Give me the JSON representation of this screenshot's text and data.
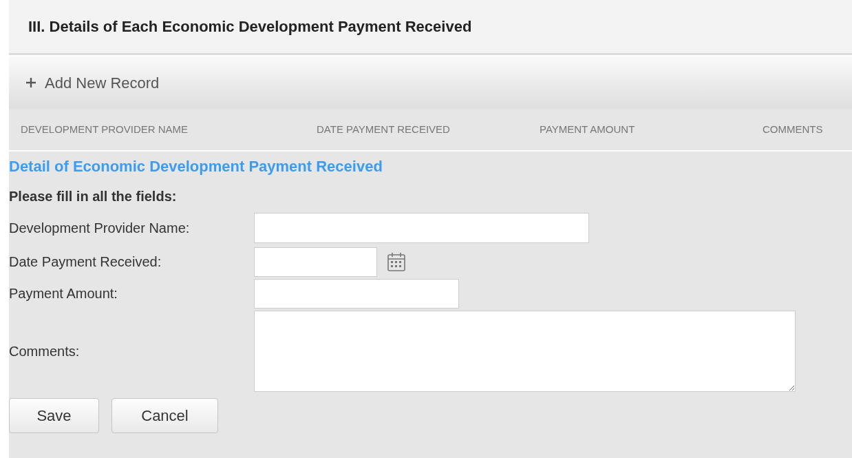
{
  "section_title": "III. Details of Each Economic Development Payment Received",
  "toolbar": {
    "add_button": "Add New Record"
  },
  "table": {
    "columns": [
      "DEVELOPMENT PROVIDER NAME",
      "DATE PAYMENT RECEIVED",
      "PAYMENT AMOUNT",
      "COMMENTS"
    ]
  },
  "form": {
    "title": "Detail of Economic Development Payment Received",
    "instruction": "Please fill in all the fields:",
    "fields": [
      {
        "label": "Development Provider Name:",
        "kind": "text"
      },
      {
        "label": "Date Payment Received:",
        "kind": "date"
      },
      {
        "label": "Payment Amount:",
        "kind": "amount"
      },
      {
        "label": "Comments:",
        "kind": "textarea"
      }
    ],
    "buttons": [
      "Save",
      "Cancel"
    ]
  }
}
